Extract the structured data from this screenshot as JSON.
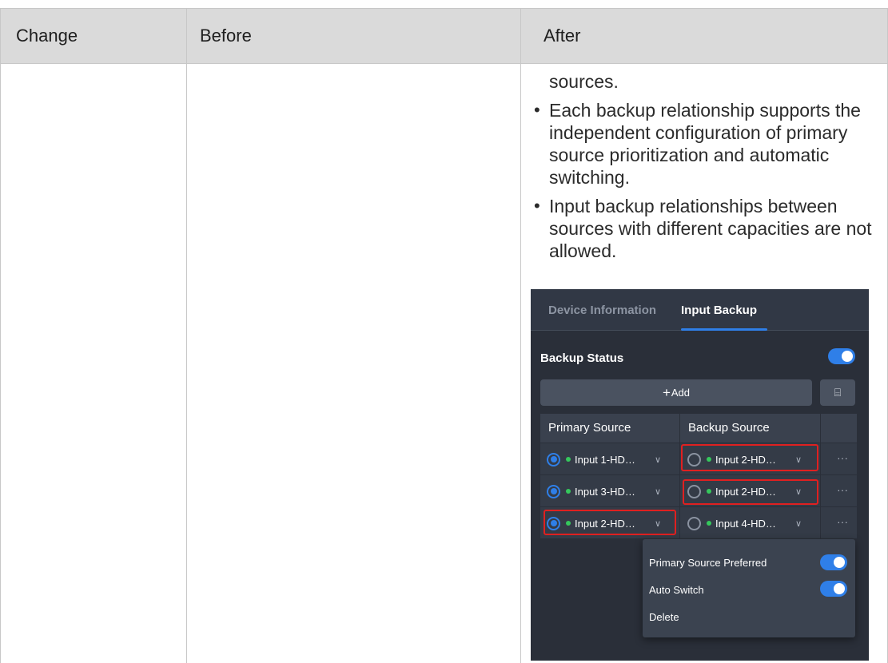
{
  "table": {
    "headers": {
      "change": "Change",
      "before": "Before",
      "after": "After"
    }
  },
  "after_text": {
    "continuation": "sources.",
    "bullets": [
      "Each backup relationship supports the independent configuration of primary source prioritization and automatic switching.",
      "Input backup relationships between sources with different capacities are not allowed."
    ]
  },
  "ui": {
    "tabs": [
      "Device Information",
      "Input Backup"
    ],
    "active_tab": "Input Backup",
    "backup_status_label": "Backup Status",
    "backup_status_on": true,
    "add_button": "Add",
    "columns": [
      "Primary Source",
      "Backup Source"
    ],
    "rows": [
      {
        "primary": "Input 1-HD…",
        "primary_selected": true,
        "backup": "Input 2-HD…",
        "backup_selected": false
      },
      {
        "primary": "Input 3-HD…",
        "primary_selected": true,
        "backup": "Input 2-HD…",
        "backup_selected": false
      },
      {
        "primary": "Input 2-HD…",
        "primary_selected": true,
        "backup": "Input 4-HD…",
        "backup_selected": false
      }
    ],
    "more_label": "···",
    "menu": {
      "primary_preferred": "Primary Source Preferred",
      "primary_preferred_on": true,
      "auto_switch": "Auto Switch",
      "auto_switch_on": true,
      "delete": "Delete"
    },
    "colors": {
      "accent": "#2f7fe8",
      "status_ok": "#35c85c",
      "highlight": "#e02020",
      "panel": "#2a2f39"
    }
  }
}
